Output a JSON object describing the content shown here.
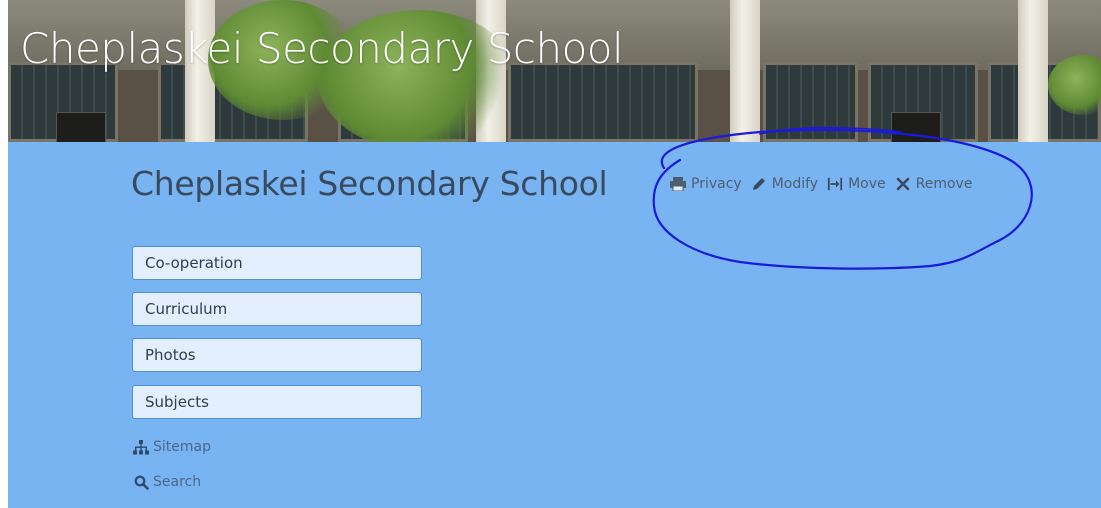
{
  "banner": {
    "title": "Cheplaskei Secondary School"
  },
  "page": {
    "title": "Cheplaskei Secondary School"
  },
  "actions": [
    {
      "label": "Privacy",
      "icon": "printer-icon"
    },
    {
      "label": "Modify",
      "icon": "pencil-icon"
    },
    {
      "label": "Move",
      "icon": "move-icon"
    },
    {
      "label": "Remove",
      "icon": "close-icon"
    }
  ],
  "nav": {
    "items": [
      {
        "label": "Co-operation"
      },
      {
        "label": "Curriculum"
      },
      {
        "label": "Photos"
      },
      {
        "label": "Subjects"
      }
    ]
  },
  "links": {
    "sitemap": "Sitemap",
    "search": "Search"
  },
  "colors": {
    "content_bg": "#78b4f2",
    "nav_box_bg": "#e3efff",
    "annotation_circle": "#1a1adc"
  }
}
